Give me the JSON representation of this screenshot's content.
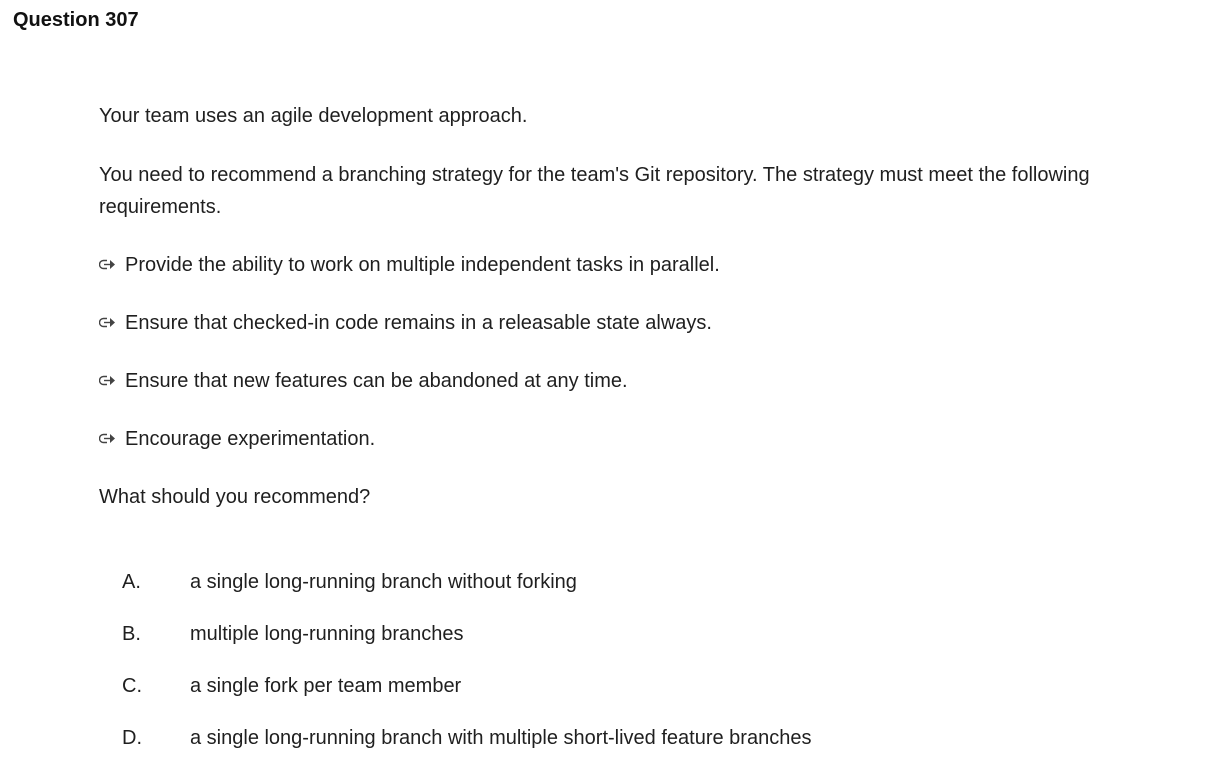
{
  "question": {
    "title": "Question 307"
  },
  "stem": {
    "intro": "Your team uses an agile development approach.",
    "task": "You need to recommend a branching strategy for the team's Git repository. The strategy must meet the following requirements.",
    "requirements": [
      {
        "icon": "bullet-arrow-icon",
        "text": "Provide the ability to work on multiple independent tasks in parallel."
      },
      {
        "icon": "bullet-arrow-icon",
        "text": "Ensure that checked-in code remains in a releasable state always."
      },
      {
        "icon": "bullet-arrow-icon",
        "text": "Ensure that new features can be abandoned at any time."
      },
      {
        "icon": "bullet-arrow-icon",
        "text": "Encourage experimentation."
      }
    ],
    "prompt": "What should you recommend?"
  },
  "options": [
    {
      "letter": "A.",
      "text": "a single long-running branch without forking"
    },
    {
      "letter": "B.",
      "text": "multiple long-running branches"
    },
    {
      "letter": "C.",
      "text": "a single fork per team member"
    },
    {
      "letter": "D.",
      "text": "a single long-running branch with multiple short-lived feature branches"
    }
  ]
}
